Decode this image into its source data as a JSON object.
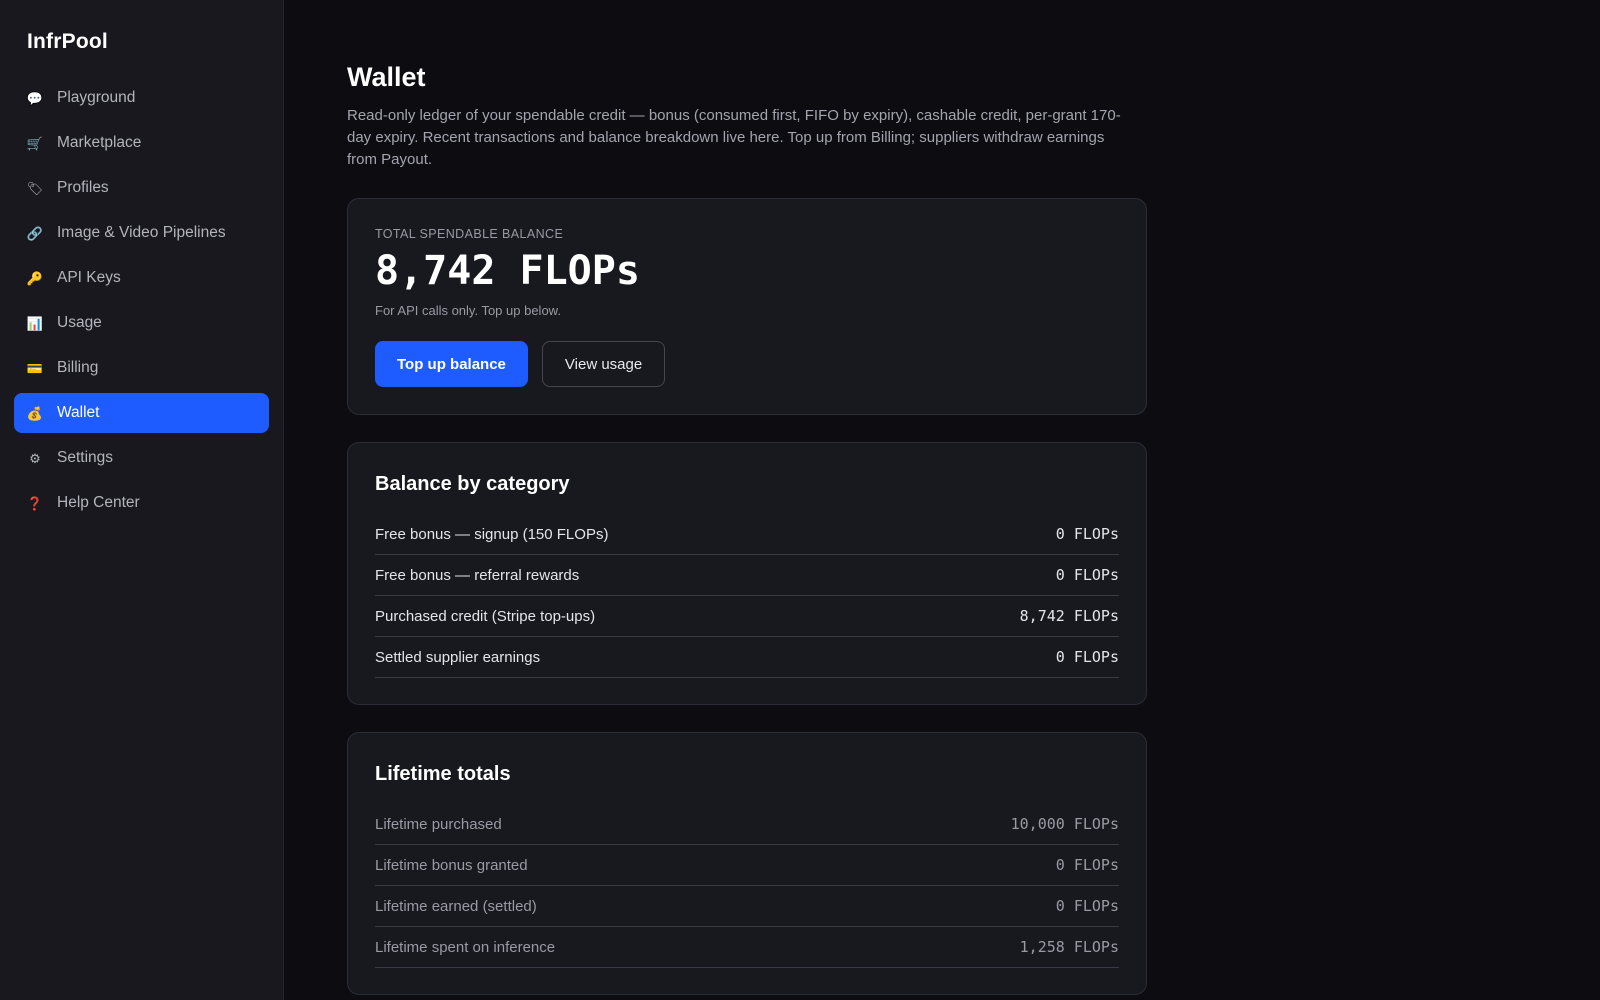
{
  "app": {
    "brand": "InfrPool"
  },
  "sidebar": {
    "items": [
      {
        "label": "Playground",
        "icon": "💬"
      },
      {
        "label": "Marketplace",
        "icon": "🛒"
      },
      {
        "label": "Profiles",
        "icon": "🏷"
      },
      {
        "label": "Image & Video Pipelines",
        "icon": "🔗"
      },
      {
        "label": "API Keys",
        "icon": "🔑"
      },
      {
        "label": "Usage",
        "icon": "📊"
      },
      {
        "label": "Billing",
        "icon": "💳"
      },
      {
        "label": "Wallet",
        "icon": "💰"
      },
      {
        "label": "Settings",
        "icon": "⚙"
      },
      {
        "label": "Help Center",
        "icon": "❓"
      }
    ],
    "active": "Wallet"
  },
  "page": {
    "title": "Wallet",
    "description": "Read-only ledger of your spendable credit — bonus (consumed first, FIFO by expiry), cashable credit, per-grant 170-day expiry. Recent transactions and balance breakdown live here. Top up from Billing; suppliers withdraw earnings from Payout."
  },
  "balance": {
    "label": "TOTAL SPENDABLE BALANCE",
    "value": "8,742 FLOPs",
    "note": "For API calls only. Top up below.",
    "top_up_label": "Top up balance",
    "view_usage_label": "View usage"
  },
  "by_category": {
    "title": "Balance by category",
    "rows": [
      {
        "label": "Free bonus — signup (150 FLOPs)",
        "value": "0 FLOPs"
      },
      {
        "label": "Free bonus — referral rewards",
        "value": "0 FLOPs"
      },
      {
        "label": "Purchased credit (Stripe top-ups)",
        "value": "8,742 FLOPs"
      },
      {
        "label": "Settled supplier earnings",
        "value": "0 FLOPs"
      }
    ]
  },
  "lifetime": {
    "title": "Lifetime totals",
    "rows": [
      {
        "label": "Lifetime purchased",
        "value": "10,000 FLOPs"
      },
      {
        "label": "Lifetime bonus granted",
        "value": "0 FLOPs"
      },
      {
        "label": "Lifetime earned (settled)",
        "value": "0 FLOPs"
      },
      {
        "label": "Lifetime spent on inference",
        "value": "1,258 FLOPs"
      }
    ]
  },
  "colors": {
    "accent": "#1f5cff",
    "background": "#0c0c11",
    "sidebar": "#18181e",
    "card": "#18181f"
  }
}
